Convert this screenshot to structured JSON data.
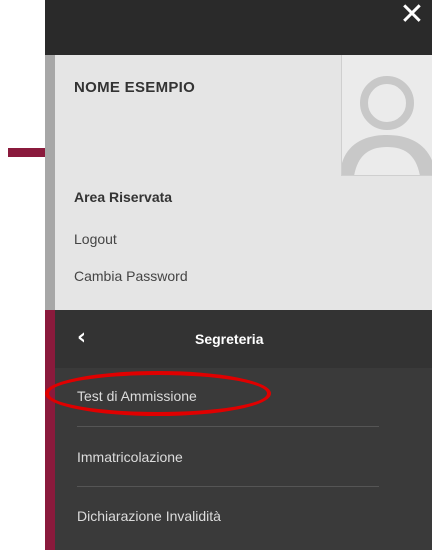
{
  "user": {
    "name": "NOME ESEMPIO",
    "area_title": "Area Riservata",
    "logout_label": "Logout",
    "change_password_label": "Cambia Password"
  },
  "menu": {
    "back_icon": "chevron-left-icon",
    "title": "Segreteria",
    "items": [
      {
        "label": "Test di Ammissione",
        "highlighted": true
      },
      {
        "label": "Immatricolazione"
      },
      {
        "label": "Dichiarazione Invalidità"
      }
    ]
  },
  "icons": {
    "close": "close-icon",
    "avatar": "user-avatar-icon"
  },
  "colors": {
    "accent": "#8a1a3c",
    "highlight": "#e00000",
    "menu_bg": "#3a3a3a",
    "panel_bg": "#e5e5e5"
  }
}
